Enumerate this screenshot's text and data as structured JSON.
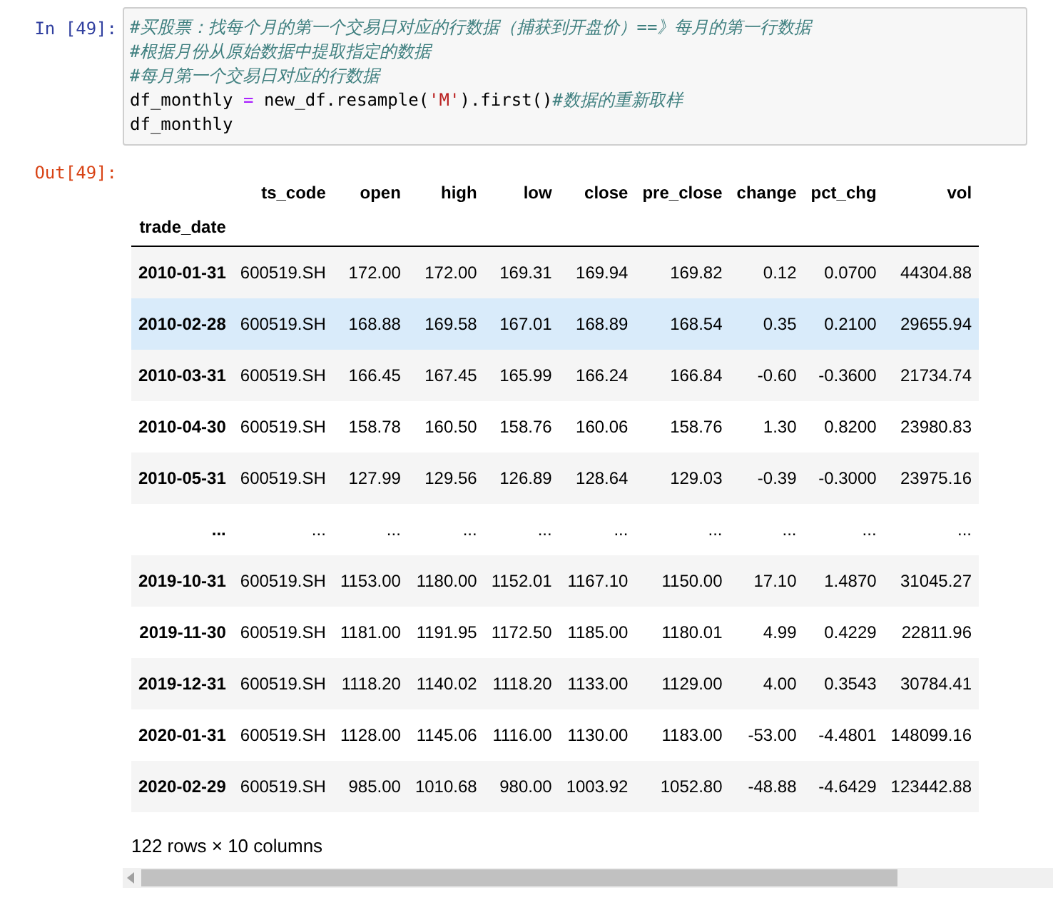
{
  "input_cell": {
    "prompt": "In [49]:",
    "lines": [
      [
        {
          "kind": "comment",
          "text": "#买股票：找每个月的第一个交易日对应的行数据（捕获到开盘价）==》每月的第一行数据"
        }
      ],
      [
        {
          "kind": "comment",
          "text": "#根据月份从原始数据中提取指定的数据"
        }
      ],
      [
        {
          "kind": "comment",
          "text": "#每月第一个交易日对应的行数据"
        }
      ],
      [
        {
          "kind": "code",
          "text": "df_monthly "
        },
        {
          "kind": "operator",
          "text": "="
        },
        {
          "kind": "code",
          "text": " new_df.resample("
        },
        {
          "kind": "string",
          "text": "'M'"
        },
        {
          "kind": "code",
          "text": ").first()"
        },
        {
          "kind": "comment",
          "text": "#数据的重新取样"
        }
      ],
      [
        {
          "kind": "code",
          "text": "df_monthly"
        }
      ]
    ]
  },
  "output_cell": {
    "prompt": "Out[49]:",
    "table": {
      "columns": [
        "ts_code",
        "open",
        "high",
        "low",
        "close",
        "pre_close",
        "change",
        "pct_chg",
        "vol"
      ],
      "index_name": "trade_date",
      "rows": [
        {
          "index": "2010-01-31",
          "selected": false,
          "cells": [
            "600519.SH",
            "172.00",
            "172.00",
            "169.31",
            "169.94",
            "169.82",
            "0.12",
            "0.0700",
            "44304.88"
          ]
        },
        {
          "index": "2010-02-28",
          "selected": true,
          "cells": [
            "600519.SH",
            "168.88",
            "169.58",
            "167.01",
            "168.89",
            "168.54",
            "0.35",
            "0.2100",
            "29655.94"
          ]
        },
        {
          "index": "2010-03-31",
          "selected": false,
          "cells": [
            "600519.SH",
            "166.45",
            "167.45",
            "165.99",
            "166.24",
            "166.84",
            "-0.60",
            "-0.3600",
            "21734.74"
          ]
        },
        {
          "index": "2010-04-30",
          "selected": false,
          "cells": [
            "600519.SH",
            "158.78",
            "160.50",
            "158.76",
            "160.06",
            "158.76",
            "1.30",
            "0.8200",
            "23980.83"
          ]
        },
        {
          "index": "2010-05-31",
          "selected": false,
          "cells": [
            "600519.SH",
            "127.99",
            "129.56",
            "126.89",
            "128.64",
            "129.03",
            "-0.39",
            "-0.3000",
            "23975.16"
          ]
        },
        {
          "index": "...",
          "selected": false,
          "cells": [
            "...",
            "...",
            "...",
            "...",
            "...",
            "...",
            "...",
            "...",
            "..."
          ]
        },
        {
          "index": "2019-10-31",
          "selected": false,
          "cells": [
            "600519.SH",
            "1153.00",
            "1180.00",
            "1152.01",
            "1167.10",
            "1150.00",
            "17.10",
            "1.4870",
            "31045.27"
          ]
        },
        {
          "index": "2019-11-30",
          "selected": false,
          "cells": [
            "600519.SH",
            "1181.00",
            "1191.95",
            "1172.50",
            "1185.00",
            "1180.01",
            "4.99",
            "0.4229",
            "22811.96"
          ]
        },
        {
          "index": "2019-12-31",
          "selected": false,
          "cells": [
            "600519.SH",
            "1118.20",
            "1140.02",
            "1118.20",
            "1133.00",
            "1129.00",
            "4.00",
            "0.3543",
            "30784.41"
          ]
        },
        {
          "index": "2020-01-31",
          "selected": false,
          "cells": [
            "600519.SH",
            "1128.00",
            "1145.06",
            "1116.00",
            "1130.00",
            "1183.00",
            "-53.00",
            "-4.4801",
            "148099.16"
          ]
        },
        {
          "index": "2020-02-29",
          "selected": false,
          "cells": [
            "600519.SH",
            "985.00",
            "1010.68",
            "980.00",
            "1003.92",
            "1052.80",
            "-48.88",
            "-4.6429",
            "123442.88"
          ]
        }
      ]
    },
    "shape": "122 rows × 10 columns"
  }
}
